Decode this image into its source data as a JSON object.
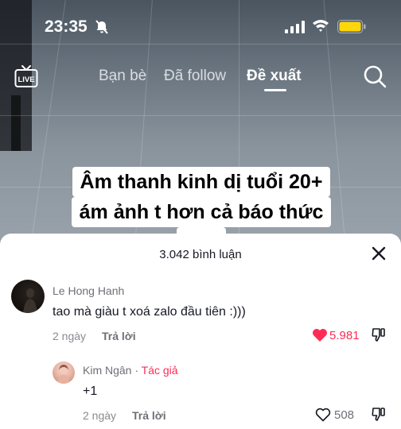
{
  "status_bar": {
    "time": "23:35"
  },
  "top_nav": {
    "live_label": "LIVE",
    "tabs": [
      {
        "label": "Bạn bè",
        "active": false
      },
      {
        "label": "Đã follow",
        "active": false
      },
      {
        "label": "Đề xuất",
        "active": true
      }
    ]
  },
  "video": {
    "caption_lines": [
      "Âm thanh kinh dị tuổi 20+",
      "ám ảnh t hơn cả báo thức",
      ":))))"
    ]
  },
  "comments_sheet": {
    "title": "3.042 bình luận",
    "comments": [
      {
        "username": "Le Hong Hanh",
        "text": "tao mà giàu t xoá zalo đầu tiên :)))",
        "age": "2 ngày",
        "reply_label": "Trả lời",
        "likes": "5.981",
        "liked": true
      }
    ],
    "replies": [
      {
        "username": "Kim Ngân",
        "separator": "·",
        "badge": "Tác giả",
        "text": "+1",
        "age": "2 ngày",
        "reply_label": "Trả lời",
        "likes": "508",
        "liked": false
      }
    ]
  },
  "colors": {
    "accent": "#fe2c55",
    "battery": "#ffd60a",
    "text": "#161823"
  }
}
